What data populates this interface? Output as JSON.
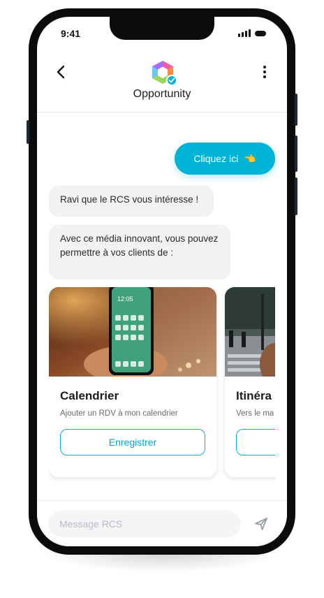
{
  "status_bar": {
    "time": "9:41"
  },
  "header": {
    "title": "Opportunity",
    "verified": true
  },
  "messages": {
    "cta_label": "Cliquez ici",
    "cta_emoji": "👈",
    "bubble1": "Ravi que le RCS vous intéresse !",
    "bubble2": "Avec ce média innovant, vous pouvez permettre à vos clients de :"
  },
  "carousel": [
    {
      "title": "Calendrier",
      "subtitle": "Ajouter un RDV à mon calendrier",
      "button": "Enregistrer"
    },
    {
      "title": "Itinéra",
      "subtitle": "Vers le ma",
      "button": ""
    }
  ],
  "phone_screen": {
    "time": "12:05"
  },
  "composer": {
    "placeholder": "Message RCS"
  },
  "colors": {
    "accent": "#00b4d8",
    "bubble": "#f1f2f4",
    "frame": "#0b0b0b"
  }
}
